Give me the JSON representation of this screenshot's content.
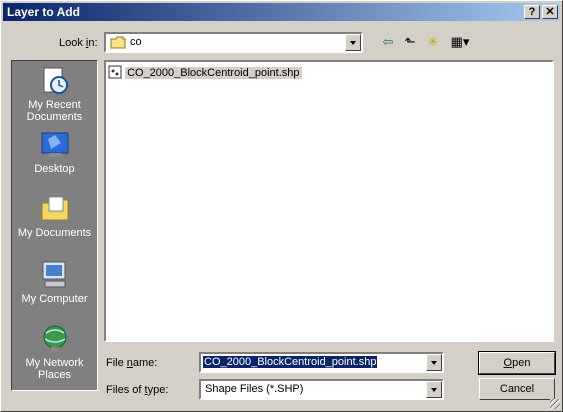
{
  "window": {
    "title": "Layer to Add",
    "help_label": "?",
    "close_label": "✕"
  },
  "lookin": {
    "label_prefix": "Look ",
    "label_accel": "i",
    "label_suffix": "n:",
    "value": "co"
  },
  "toolbar": {
    "back_icon": "⇦",
    "up_icon": "⬑",
    "newfolder_icon": "✳",
    "views_icon": "▦▾"
  },
  "places": [
    {
      "label_line1": "My Recent",
      "label_line2": "Documents"
    },
    {
      "label_line1": "Desktop",
      "label_line2": ""
    },
    {
      "label_line1": "My Documents",
      "label_line2": ""
    },
    {
      "label_line1": "My Computer",
      "label_line2": ""
    },
    {
      "label_line1": "My Network",
      "label_line2": "Places"
    }
  ],
  "files": [
    {
      "name": "CO_2000_BlockCentroid_point.shp"
    }
  ],
  "filename": {
    "label_prefix": "File ",
    "label_accel": "n",
    "label_suffix": "ame:",
    "value": "CO_2000_BlockCentroid_point.shp"
  },
  "filetype": {
    "label_prefix": "Files of ",
    "label_accel": "t",
    "label_suffix": "ype:",
    "value": "Shape Files (*.SHP)"
  },
  "buttons": {
    "open_accel": "O",
    "open_rest": "pen",
    "cancel": "Cancel"
  }
}
